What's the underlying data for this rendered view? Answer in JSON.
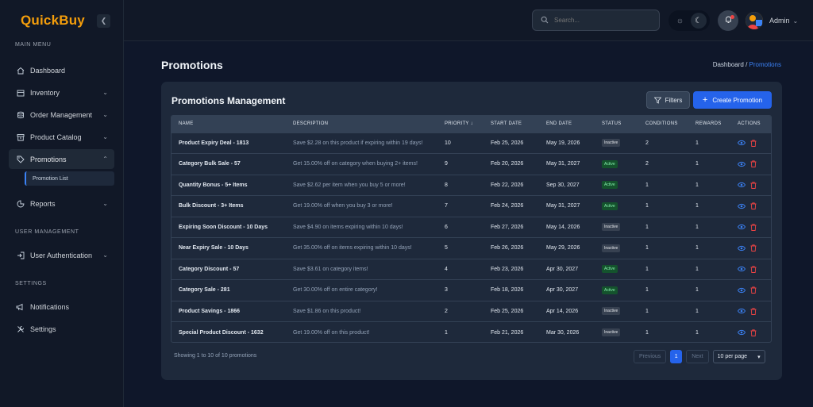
{
  "app": {
    "name": "QuickBuy"
  },
  "sidebar": {
    "sections": [
      {
        "label": "MAIN MENU"
      },
      {
        "label": "USER MANAGEMENT"
      },
      {
        "label": "SETTINGS"
      }
    ],
    "items": [
      {
        "label": "Dashboard",
        "icon": "home-icon"
      },
      {
        "label": "Inventory",
        "icon": "inventory-icon"
      },
      {
        "label": "Order Management",
        "icon": "database-icon"
      },
      {
        "label": "Product Catalog",
        "icon": "archive-icon"
      },
      {
        "label": "Promotions",
        "icon": "tag-icon"
      },
      {
        "label": "Reports",
        "icon": "chart-icon"
      },
      {
        "label": "User Authentication",
        "icon": "login-icon"
      },
      {
        "label": "Notifications",
        "icon": "megaphone-icon"
      },
      {
        "label": "Settings",
        "icon": "tools-icon"
      }
    ],
    "sub_item": {
      "label": "Promotion List"
    }
  },
  "topbar": {
    "search_placeholder": "Search...",
    "user_name": "Admin"
  },
  "page": {
    "title": "Promotions",
    "breadcrumb": {
      "parent": "Dashboard",
      "separator": "/",
      "current": "Promotions"
    }
  },
  "card": {
    "title": "Promotions Management",
    "filters_label": "Filters",
    "create_label": "Create Promotion"
  },
  "table": {
    "headers": [
      "NAME",
      "DESCRIPTION",
      "PRIORITY ↓",
      "START DATE",
      "END DATE",
      "STATUS",
      "CONDITIONS",
      "REWARDS",
      "ACTIONS"
    ],
    "rows": [
      {
        "name": "Product Expiry Deal - 1813",
        "description": "Save $2.28 on this product if expiring within 19 days!",
        "priority": "10",
        "start": "Feb 25, 2026",
        "end": "May 19, 2026",
        "status": "Inactive",
        "conditions": "2",
        "rewards": "1"
      },
      {
        "name": "Category Bulk Sale - 57",
        "description": "Get 15.00% off on category when buying 2+ items!",
        "priority": "9",
        "start": "Feb 20, 2026",
        "end": "May 31, 2027",
        "status": "Active",
        "conditions": "2",
        "rewards": "1"
      },
      {
        "name": "Quantity Bonus - 5+ Items",
        "description": "Save $2.62 per item when you buy 5 or more!",
        "priority": "8",
        "start": "Feb 22, 2026",
        "end": "Sep 30, 2027",
        "status": "Active",
        "conditions": "1",
        "rewards": "1"
      },
      {
        "name": "Bulk Discount - 3+ Items",
        "description": "Get 19.00% off when you buy 3 or more!",
        "priority": "7",
        "start": "Feb 24, 2026",
        "end": "May 31, 2027",
        "status": "Active",
        "conditions": "1",
        "rewards": "1"
      },
      {
        "name": "Expiring Soon Discount - 10 Days",
        "description": "Save $4.90 on items expiring within 10 days!",
        "priority": "6",
        "start": "Feb 27, 2026",
        "end": "May 14, 2026",
        "status": "Inactive",
        "conditions": "1",
        "rewards": "1"
      },
      {
        "name": "Near Expiry Sale - 10 Days",
        "description": "Get 35.00% off on items expiring within 10 days!",
        "priority": "5",
        "start": "Feb 26, 2026",
        "end": "May 29, 2026",
        "status": "Inactive",
        "conditions": "1",
        "rewards": "1"
      },
      {
        "name": "Category Discount - 57",
        "description": "Save $3.61 on category items!",
        "priority": "4",
        "start": "Feb 23, 2026",
        "end": "Apr 30, 2027",
        "status": "Active",
        "conditions": "1",
        "rewards": "1"
      },
      {
        "name": "Category Sale - 281",
        "description": "Get 30.00% off on entire category!",
        "priority": "3",
        "start": "Feb 18, 2026",
        "end": "Apr 30, 2027",
        "status": "Active",
        "conditions": "1",
        "rewards": "1"
      },
      {
        "name": "Product Savings - 1866",
        "description": "Save $1.86 on this product!",
        "priority": "2",
        "start": "Feb 25, 2026",
        "end": "Apr 14, 2026",
        "status": "Inactive",
        "conditions": "1",
        "rewards": "1"
      },
      {
        "name": "Special Product Discount - 1632",
        "description": "Get 19.00% off on this product!",
        "priority": "1",
        "start": "Feb 21, 2026",
        "end": "Mar 30, 2026",
        "status": "Inactive",
        "conditions": "1",
        "rewards": "1"
      }
    ]
  },
  "footer": {
    "summary": "Showing 1 to 10 of 10 promotions",
    "previous": "Previous",
    "page": "1",
    "next": "Next",
    "per_page": "10 per page"
  },
  "colors": {
    "accent": "#2563eb",
    "brand": "#f59e0b",
    "active_badge": "#14532d",
    "inactive_badge": "#374151"
  }
}
